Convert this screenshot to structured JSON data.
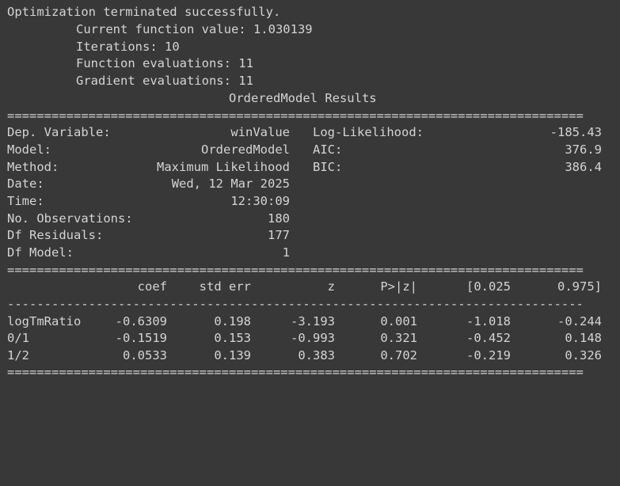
{
  "log": {
    "message": "Optimization terminated successfully.",
    "current_value": "Current function value: 1.030139",
    "iterations": "Iterations: 10",
    "func_evals": "Function evaluations: 11",
    "grad_evals": "Gradient evaluations: 11"
  },
  "results_title": "OrderedModel Results",
  "separators": {
    "double": "==============================================================================",
    "single": "------------------------------------------------------------------------------"
  },
  "summary": {
    "dep_variable_label": "Dep. Variable:",
    "dep_variable_value": "winValue",
    "model_label": "Model:",
    "model_value": "OrderedModel",
    "method_label": "Method:",
    "method_value": "Maximum Likelihood",
    "date_label": "Date:",
    "date_value": "Wed, 12 Mar 2025",
    "time_label": "Time:",
    "time_value": "12:30:09",
    "nobs_label": "No. Observations:",
    "nobs_value": "180",
    "df_resid_label": "Df Residuals:",
    "df_resid_value": "177",
    "df_model_label": "Df Model:",
    "df_model_value": "1",
    "loglik_label": "Log-Likelihood:",
    "loglik_value": "-185.43",
    "aic_label": "AIC:",
    "aic_value": "376.9",
    "bic_label": "BIC:",
    "bic_value": "386.4"
  },
  "coef_table": {
    "headers": {
      "coef": "coef",
      "std_err": "std err",
      "z": "z",
      "pval": "P>|z|",
      "ci_low": "[0.025",
      "ci_high": "0.975]"
    },
    "rows": [
      {
        "name": "logTmRatio",
        "coef": "-0.6309",
        "std_err": "0.198",
        "z": "-3.193",
        "pval": "0.001",
        "ci_low": "-1.018",
        "ci_high": "-0.244"
      },
      {
        "name": "0/1",
        "coef": "-0.1519",
        "std_err": "0.153",
        "z": "-0.993",
        "pval": "0.321",
        "ci_low": "-0.452",
        "ci_high": "0.148"
      },
      {
        "name": "1/2",
        "coef": "0.0533",
        "std_err": "0.139",
        "z": "0.383",
        "pval": "0.702",
        "ci_low": "-0.219",
        "ci_high": "0.326"
      }
    ]
  }
}
